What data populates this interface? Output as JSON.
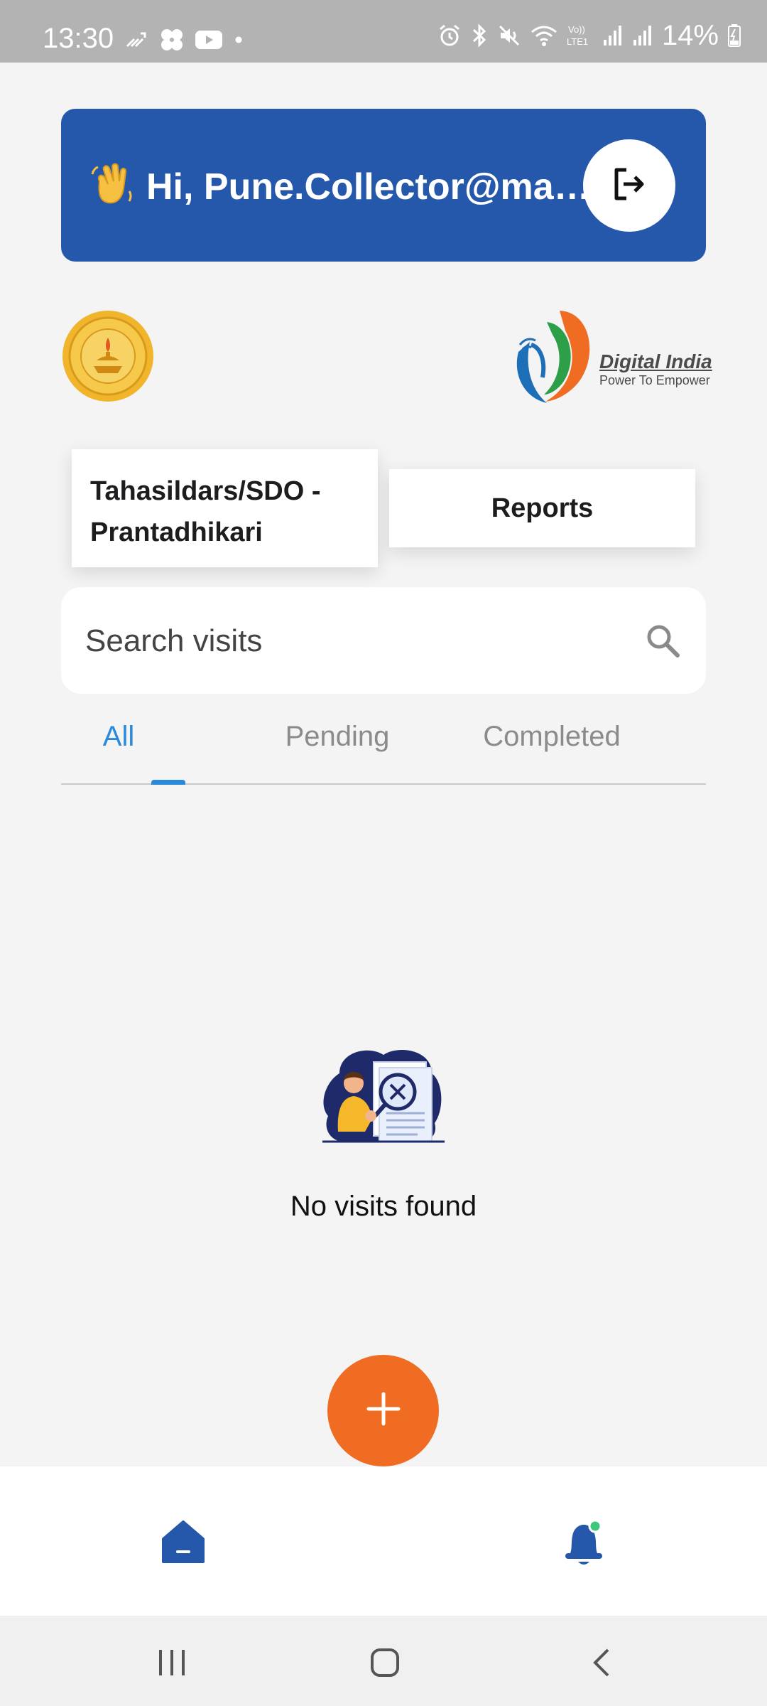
{
  "status_bar": {
    "time": "13:30",
    "battery": "14%",
    "icons": [
      "missed-call-icon",
      "fan-app-icon",
      "youtube-icon",
      "dot-icon",
      "alarm-icon",
      "bluetooth-icon",
      "mute-icon",
      "wifi-icon",
      "volte-icon",
      "signal-icon",
      "signal-icon",
      "battery-charging-icon"
    ]
  },
  "header": {
    "greeting": "Hi, Pune.Collector@ma…",
    "emoji": "waving-hand-icon",
    "logout_icon": "logout-icon",
    "background": "#2558ab"
  },
  "logos": {
    "left": "maharashtra-emblem",
    "right_title": "Digital India",
    "right_subtitle": "Power To Empower"
  },
  "cards": {
    "tahasildars": "Tahasildars/SDO - Prantadhikari",
    "reports": "Reports"
  },
  "search": {
    "placeholder": "Search visits",
    "icon": "search-icon"
  },
  "tabs": {
    "items": [
      "All",
      "Pending",
      "Completed"
    ],
    "active": "All",
    "active_color": "#2a8ad9"
  },
  "empty_state": {
    "message": "No visits found",
    "illustration": "no-results-illustration"
  },
  "fab": {
    "icon": "plus-icon",
    "color": "#ef6c22"
  },
  "bottom_nav": {
    "items": [
      "home-icon",
      "notification-bell-icon"
    ]
  },
  "system_nav": {
    "items": [
      "recents-icon",
      "home-circle-icon",
      "back-icon"
    ]
  }
}
